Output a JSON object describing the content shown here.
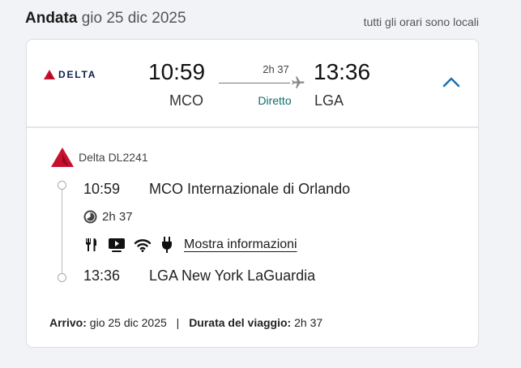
{
  "header": {
    "direction": "Andata",
    "date": "gio 25 dic 2025",
    "local_note": "tutti gli orari sono locali"
  },
  "summary": {
    "airline_logo_text": "DELTA",
    "depart_time": "10:59",
    "depart_code": "MCO",
    "duration": "2h 37",
    "stops": "Diretto",
    "arrive_time": "13:36",
    "arrive_code": "LGA"
  },
  "segment": {
    "carrier": "Delta DL2241",
    "depart_time": "10:59",
    "depart_place": "MCO Internazionale di Orlando",
    "duration": "2h 37",
    "amenity_icons": [
      "meal-icon",
      "entertainment-icon",
      "wifi-icon",
      "power-icon"
    ],
    "more_info": "Mostra informazioni",
    "arrive_time": "13:36",
    "arrive_place": "LGA New York LaGuardia"
  },
  "footer": {
    "arrival_label": "Arrivo:",
    "arrival_value": "gio 25 dic 2025",
    "separator": "|",
    "trip_duration_label": "Durata del viaggio:",
    "trip_duration_value": "2h 37"
  },
  "colors": {
    "accent": "#1a6fb3",
    "direct": "#0f6b71",
    "delta_red": "#c8102e",
    "delta_navy": "#0b1f4e"
  }
}
